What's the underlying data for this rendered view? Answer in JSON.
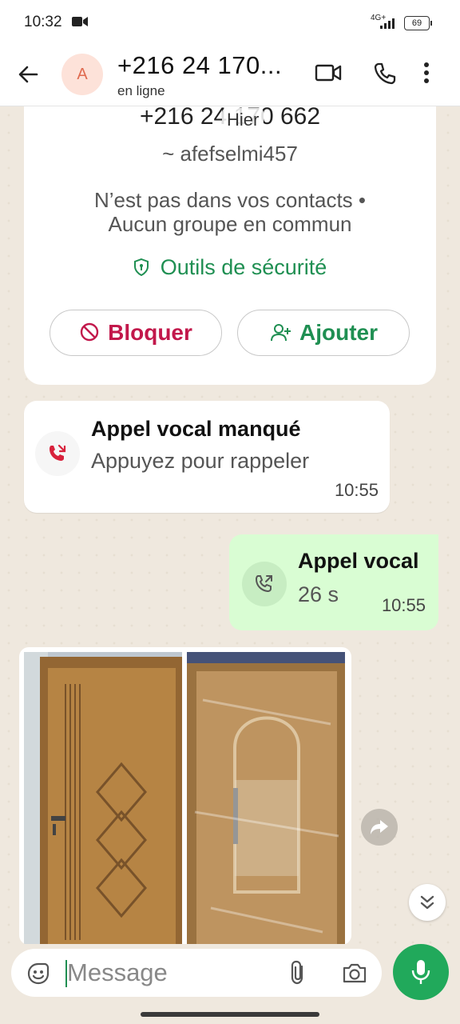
{
  "status_bar": {
    "time": "10:32",
    "network": "4G+",
    "battery": "69"
  },
  "header": {
    "avatar_letter": "A",
    "title": "+216 24 170...",
    "subtitle": "en ligne",
    "icons": [
      "back-arrow-icon",
      "video-call-icon",
      "voice-call-icon",
      "more-options-icon"
    ]
  },
  "contact_card": {
    "phone": "+216 24 170 662",
    "date_chip": "Hier",
    "username": "~ afefselmi457",
    "info_line1": "N’est pas dans vos contacts •",
    "info_line2": "Aucun groupe en commun",
    "safety_tools": "Outils de sécurité",
    "block_label": "Bloquer",
    "add_label": "Ajouter"
  },
  "messages": [
    {
      "type": "missed_call",
      "title": "Appel vocal manqué",
      "subtitle": "Appuyez pour rappeler",
      "time": "10:55"
    },
    {
      "type": "outgoing_call",
      "title": "Appel vocal",
      "duration": "26 s",
      "time": "10:55"
    }
  ],
  "composer": {
    "placeholder": "Message"
  },
  "colors": {
    "green": "#1f8f52",
    "red": "#c2184b",
    "outgoing_bubble": "#d9fdd3",
    "mic_button": "#21a95b"
  }
}
